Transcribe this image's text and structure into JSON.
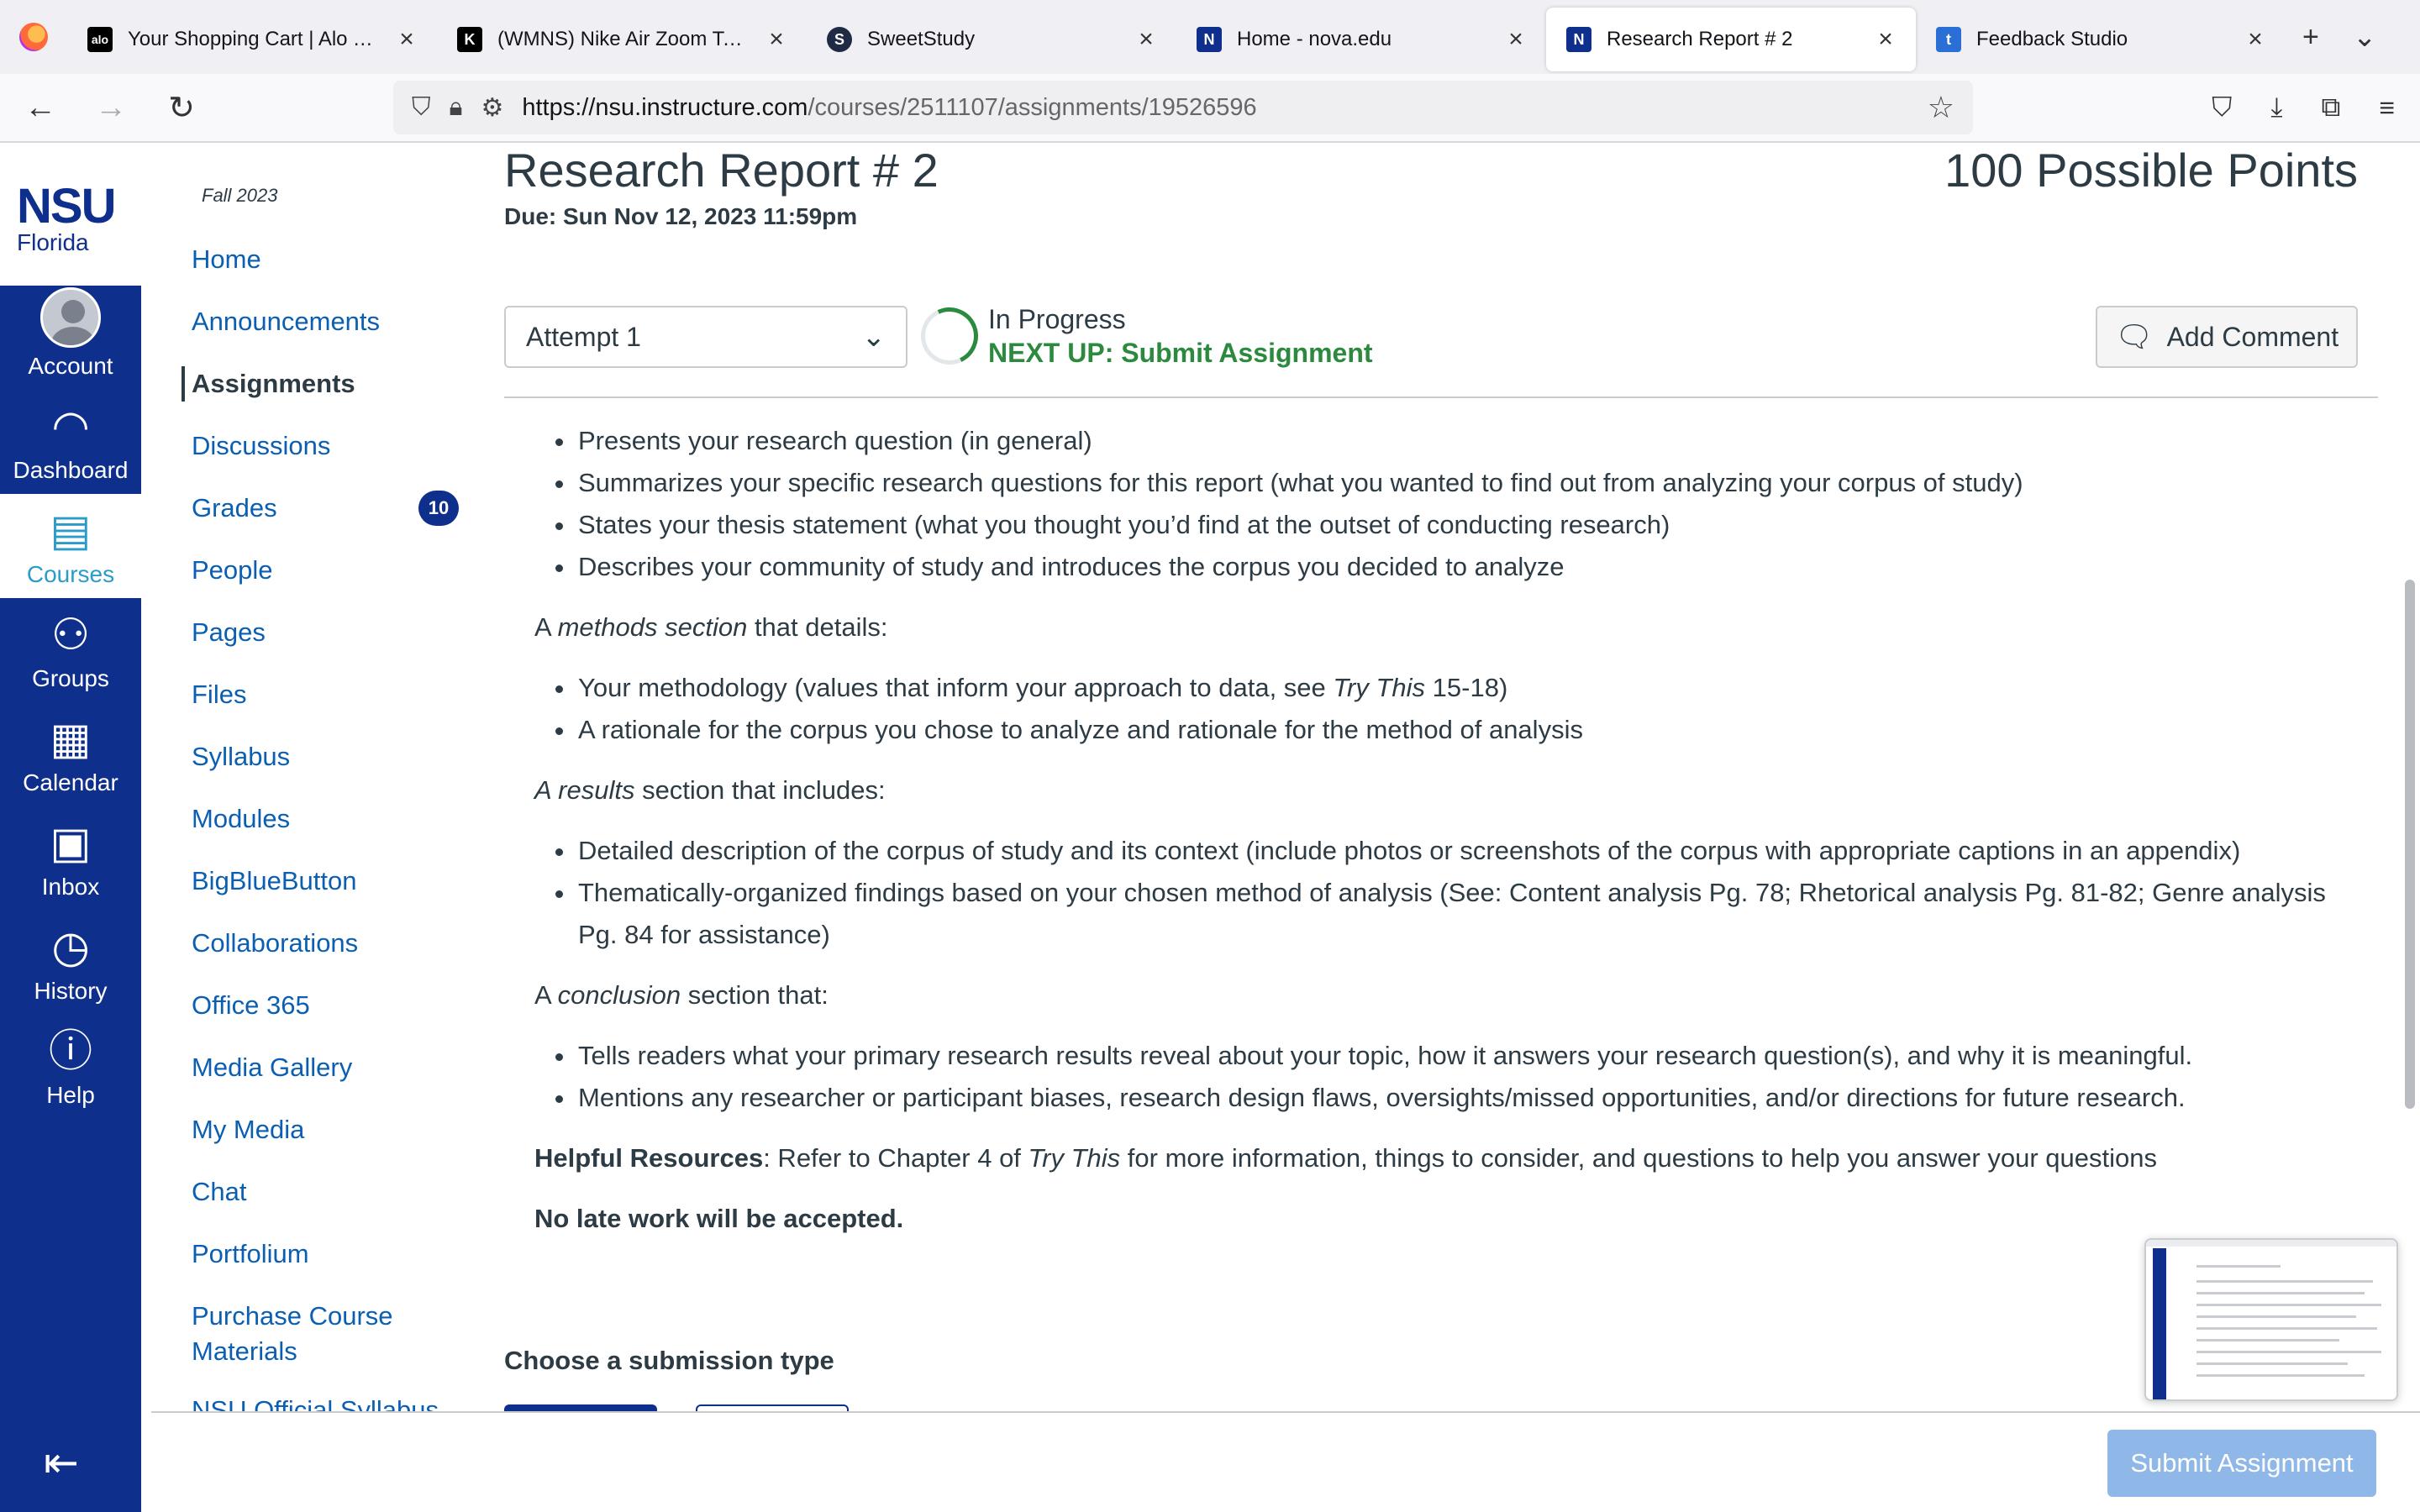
{
  "browser": {
    "tabs": [
      {
        "label": "Your Shopping Cart | Alo Yoga",
        "fav": "alo",
        "fav_color": "#000000",
        "active": false
      },
      {
        "label": "(WMNS) Nike Air Zoom Tempo",
        "fav": "K",
        "fav_color": "#000000",
        "active": false
      },
      {
        "label": "SweetStudy",
        "fav": "S",
        "fav_color": "#1f2a44",
        "active": false
      },
      {
        "label": "Home - nova.edu",
        "fav": "N",
        "fav_color": "#0f2f8d",
        "active": false
      },
      {
        "label": "Research Report # 2",
        "fav": "N",
        "fav_color": "#0f2f8d",
        "active": true
      },
      {
        "label": "Feedback Studio",
        "fav": "t",
        "fav_color": "#2a6fd6",
        "active": false
      }
    ],
    "url_host": "https://nsu.instructure.com",
    "url_path": "/courses/2511107/assignments/19526596"
  },
  "global_nav": {
    "logo_main": "NSU",
    "logo_sub": "Florida",
    "items": [
      {
        "label": "Account",
        "icon": "user-avatar"
      },
      {
        "label": "Dashboard",
        "icon": "dashboard-gauge-icon"
      },
      {
        "label": "Courses",
        "icon": "book-icon"
      },
      {
        "label": "Groups",
        "icon": "groups-icon"
      },
      {
        "label": "Calendar",
        "icon": "calendar-icon"
      },
      {
        "label": "Inbox",
        "icon": "inbox-icon"
      },
      {
        "label": "History",
        "icon": "clock-icon"
      },
      {
        "label": "Help",
        "icon": "question-icon"
      }
    ]
  },
  "course_nav": {
    "term": "Fall 2023",
    "items": [
      "Home",
      "Announcements",
      "Assignments",
      "Discussions",
      "Grades",
      "People",
      "Pages",
      "Files",
      "Syllabus",
      "Modules",
      "BigBlueButton",
      "Collaborations",
      "Office 365",
      "Media Gallery",
      "My Media",
      "Chat",
      "Portfolium",
      "Purchase Course Materials",
      "NSU Official Syllabus"
    ],
    "purchase_line1": "Purchase Course",
    "purchase_line2": "Materials",
    "grades_badge": "10",
    "active": "Assignments"
  },
  "assignment": {
    "title": "Research Report # 2",
    "points": "100 Possible Points",
    "due": "Due: Sun Nov 12, 2023 11:59pm",
    "attempt": "Attempt 1",
    "status": "In Progress",
    "next_up": "NEXT UP: Submit Assignment",
    "add_comment": "Add Comment",
    "bullets_intro": [
      "Presents your research question (in general)",
      "Summarizes your specific research questions for this report (what you wanted to find out from analyzing your corpus of study)",
      "States your thesis statement (what you thought you’d find at the outset of conducting research)",
      "Describes your community of study and introduces the corpus you decided to analyze"
    ],
    "methods_pre": "A ",
    "methods_em": "methods section",
    "methods_post": " that details:",
    "methods_b1_pre": "Your methodology (values that inform your approach to data, see ",
    "methods_b1_em": "Try This",
    "methods_b1_post": " 15-18)",
    "methods_b2": "A rationale for the corpus you chose to analyze and rationale for the method of analysis",
    "results_em": "A results",
    "results_post": " section that includes:",
    "results_b1": "Detailed description of the corpus of study and its context (include photos or screenshots of the corpus with appropriate captions in an appendix)",
    "results_b2": "Thematically-organized findings based on your chosen method of analysis (See: Content analysis Pg. 78; Rhetorical analysis Pg. 81-82; Genre analysis Pg. 84 for assistance)",
    "conclusion_pre": "A ",
    "conclusion_em": "conclusion",
    "conclusion_post": " section that:",
    "conclusion_b1": "Tells readers what your primary research results reveal about your topic, how it answers your research question(s), and why it is meaningful.",
    "conclusion_b2": "Mentions any researcher or participant biases, research design flaws, oversights/missed opportunities, and/or directions for future research.",
    "helpful_label": "Helpful Resources",
    "helpful_pre": ": Refer to Chapter 4 of ",
    "helpful_em": "Try This",
    "helpful_post": " for more information, things to consider, and questions to help you answer your questions",
    "late": "No late work will be accepted.",
    "submission_type": "Choose a submission type",
    "submit": "Submit Assignment"
  }
}
